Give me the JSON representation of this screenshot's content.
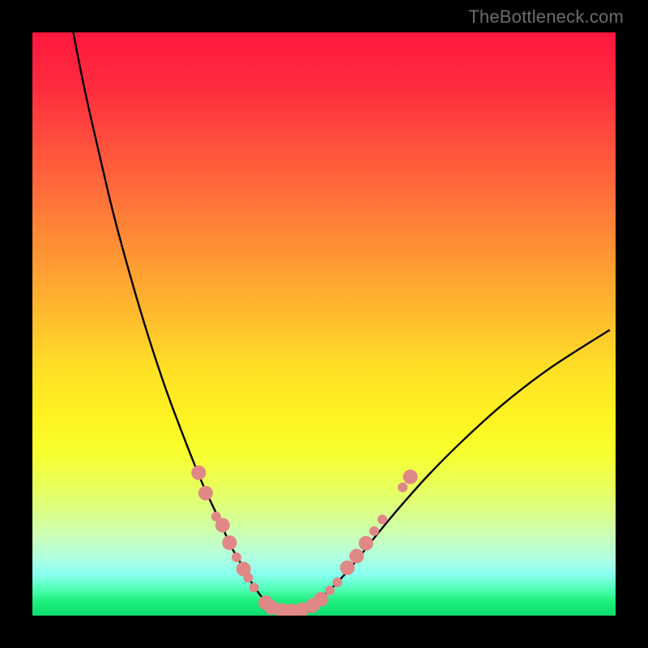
{
  "watermark": "TheBottleneck.com",
  "chart_data": {
    "type": "line",
    "title": "",
    "xlabel": "",
    "ylabel": "",
    "xlim": [
      0,
      100
    ],
    "ylim": [
      0,
      100
    ],
    "grid": false,
    "legend": false,
    "background": {
      "stops": [
        {
          "pos": 0.0,
          "color": "#ff173e"
        },
        {
          "pos": 0.1,
          "color": "#ff2e3f"
        },
        {
          "pos": 0.22,
          "color": "#ff5a3c"
        },
        {
          "pos": 0.35,
          "color": "#ff8a36"
        },
        {
          "pos": 0.48,
          "color": "#ffb92e"
        },
        {
          "pos": 0.58,
          "color": "#ffe126"
        },
        {
          "pos": 0.66,
          "color": "#fff321"
        },
        {
          "pos": 0.72,
          "color": "#f8ff2e"
        },
        {
          "pos": 0.78,
          "color": "#e8ff5c"
        },
        {
          "pos": 0.83,
          "color": "#d8ff90"
        },
        {
          "pos": 0.87,
          "color": "#c8ffc0"
        },
        {
          "pos": 0.9,
          "color": "#b0ffe0"
        },
        {
          "pos": 0.93,
          "color": "#88fff0"
        },
        {
          "pos": 0.955,
          "color": "#4fffb4"
        },
        {
          "pos": 0.975,
          "color": "#1ef07b"
        },
        {
          "pos": 1.0,
          "color": "#0bdc6e"
        }
      ]
    },
    "series": [
      {
        "name": "bottleneck-curve",
        "color": "#000000",
        "x": [
          7.0,
          9.0,
          11.5,
          14.0,
          17.0,
          20.0,
          23.0,
          26.0,
          29.0,
          32.0,
          34.0,
          36.0,
          37.5,
          39.0,
          40.5,
          42.0,
          44.0,
          46.0,
          48.5,
          51.0,
          53.5,
          56.0,
          59.0,
          63.0,
          68.0,
          74.0,
          81.0,
          89.0,
          99.0
        ],
        "y": [
          100.0,
          90.0,
          79.0,
          68.5,
          57.5,
          47.5,
          38.5,
          30.5,
          23.0,
          16.5,
          12.0,
          8.5,
          5.8,
          3.6,
          2.0,
          1.0,
          0.8,
          1.2,
          2.4,
          4.4,
          7.0,
          10.0,
          13.8,
          18.6,
          24.2,
          30.2,
          36.5,
          42.6,
          49.0
        ]
      }
    ],
    "markers": {
      "color": "#e08787",
      "radius_major": 9,
      "radius_minor": 6,
      "points": [
        {
          "x": 28.5,
          "y": 24.5,
          "r": "major"
        },
        {
          "x": 29.7,
          "y": 21.0,
          "r": "major"
        },
        {
          "x": 31.5,
          "y": 17.0,
          "r": "minor"
        },
        {
          "x": 32.6,
          "y": 15.5,
          "r": "major"
        },
        {
          "x": 33.8,
          "y": 12.5,
          "r": "major"
        },
        {
          "x": 35.0,
          "y": 10.0,
          "r": "minor"
        },
        {
          "x": 36.2,
          "y": 8.0,
          "r": "major"
        },
        {
          "x": 37.0,
          "y": 6.5,
          "r": "minor"
        },
        {
          "x": 38.0,
          "y": 4.8,
          "r": "minor"
        },
        {
          "x": 40.0,
          "y": 2.2,
          "r": "major"
        },
        {
          "x": 41.0,
          "y": 1.4,
          "r": "major"
        },
        {
          "x": 42.8,
          "y": 0.9,
          "r": "major"
        },
        {
          "x": 44.5,
          "y": 0.8,
          "r": "major"
        },
        {
          "x": 46.2,
          "y": 1.0,
          "r": "major"
        },
        {
          "x": 48.0,
          "y": 1.7,
          "r": "major"
        },
        {
          "x": 49.5,
          "y": 2.8,
          "r": "major"
        },
        {
          "x": 51.0,
          "y": 4.3,
          "r": "minor"
        },
        {
          "x": 52.3,
          "y": 5.7,
          "r": "minor"
        },
        {
          "x": 54.0,
          "y": 8.2,
          "r": "major"
        },
        {
          "x": 55.6,
          "y": 10.2,
          "r": "major"
        },
        {
          "x": 57.2,
          "y": 12.4,
          "r": "major"
        },
        {
          "x": 58.6,
          "y": 14.5,
          "r": "minor"
        },
        {
          "x": 60.0,
          "y": 16.5,
          "r": "minor"
        },
        {
          "x": 63.5,
          "y": 22.0,
          "r": "minor"
        },
        {
          "x": 64.8,
          "y": 23.8,
          "r": "major"
        }
      ]
    }
  }
}
